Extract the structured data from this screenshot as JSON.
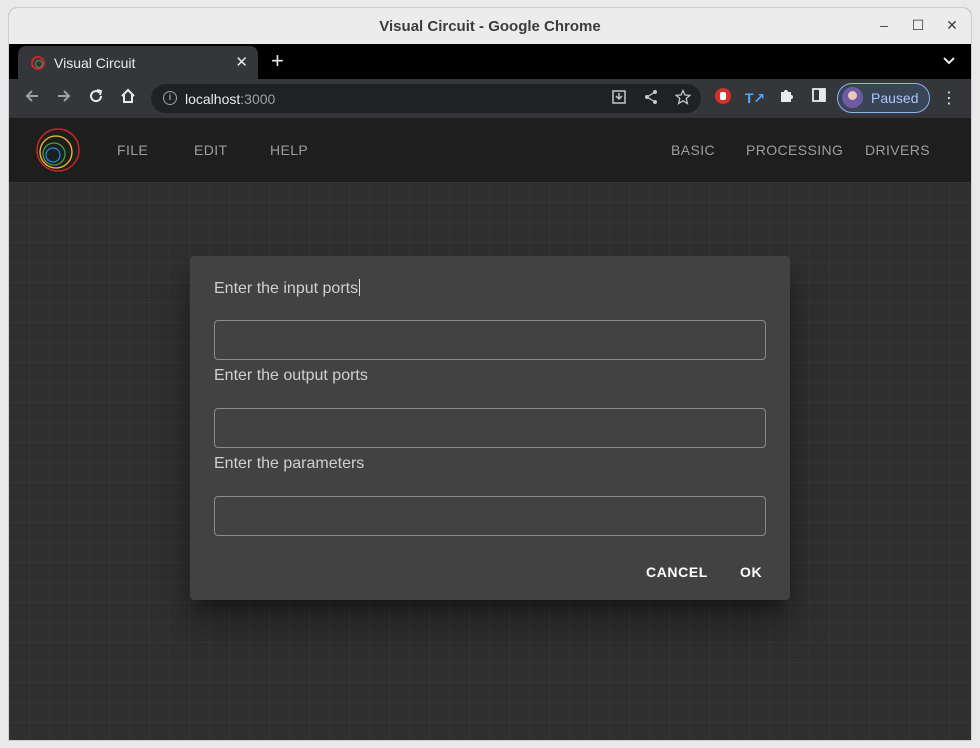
{
  "window": {
    "title": "Visual Circuit - Google Chrome",
    "minimize": "–",
    "maximize": "☐",
    "close": "✕"
  },
  "tab": {
    "title": "Visual Circuit",
    "close": "✕",
    "new_tab": "+",
    "tab_menu": "⌄"
  },
  "omnibox": {
    "host": "localhost",
    "port": ":3000"
  },
  "profile": {
    "label": "Paused"
  },
  "app": {
    "menu_left": [
      "FILE",
      "EDIT",
      "HELP"
    ],
    "menu_right": [
      "BASIC",
      "PROCESSING",
      "DRIVERS"
    ]
  },
  "dialog": {
    "input_label": "Enter the input ports",
    "output_label": "Enter the output ports",
    "params_label": "Enter the parameters",
    "input_value": "",
    "output_value": "",
    "params_value": "",
    "cancel": "CANCEL",
    "ok": "OK"
  },
  "colors": {
    "canvas": "#2f2f2f",
    "dialog": "#424242",
    "appbar": "#1e1e1e",
    "profile_accent": "#8ab4f8"
  }
}
